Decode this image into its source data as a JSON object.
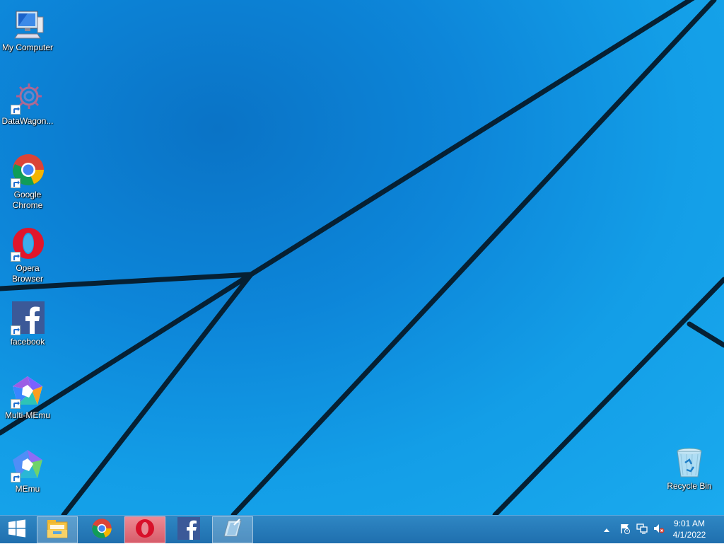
{
  "desktop": {
    "icons": [
      {
        "label": "My Computer",
        "icon": "computer-icon"
      },
      {
        "label": "DataWagon...",
        "icon": "datawagon-icon"
      },
      {
        "label": "Google Chrome",
        "icon": "chrome-icon"
      },
      {
        "label": "Opera Browser",
        "icon": "opera-icon"
      },
      {
        "label": "facebook",
        "icon": "facebook-icon"
      },
      {
        "label": "Multi-MEmu",
        "icon": "multi-memu-icon"
      },
      {
        "label": "MEmu",
        "icon": "memu-icon"
      },
      {
        "label": "Recycle Bin",
        "icon": "recycle-bin-icon"
      }
    ],
    "background_color": "#139ee7"
  },
  "taskbar": {
    "buttons": [
      {
        "icon": "windows-start-icon"
      },
      {
        "icon": "file-explorer-icon"
      },
      {
        "icon": "chrome-icon"
      },
      {
        "icon": "opera-icon"
      },
      {
        "icon": "facebook-icon"
      },
      {
        "icon": "screenshot-tool-icon"
      }
    ],
    "tray": {
      "icons": [
        "show-hidden-icons-chevron",
        "action-center-flag-icon",
        "network-icon",
        "volume-muted-icon"
      ]
    },
    "clock": {
      "time": "9:01 AM",
      "date": "4/1/2022"
    }
  }
}
